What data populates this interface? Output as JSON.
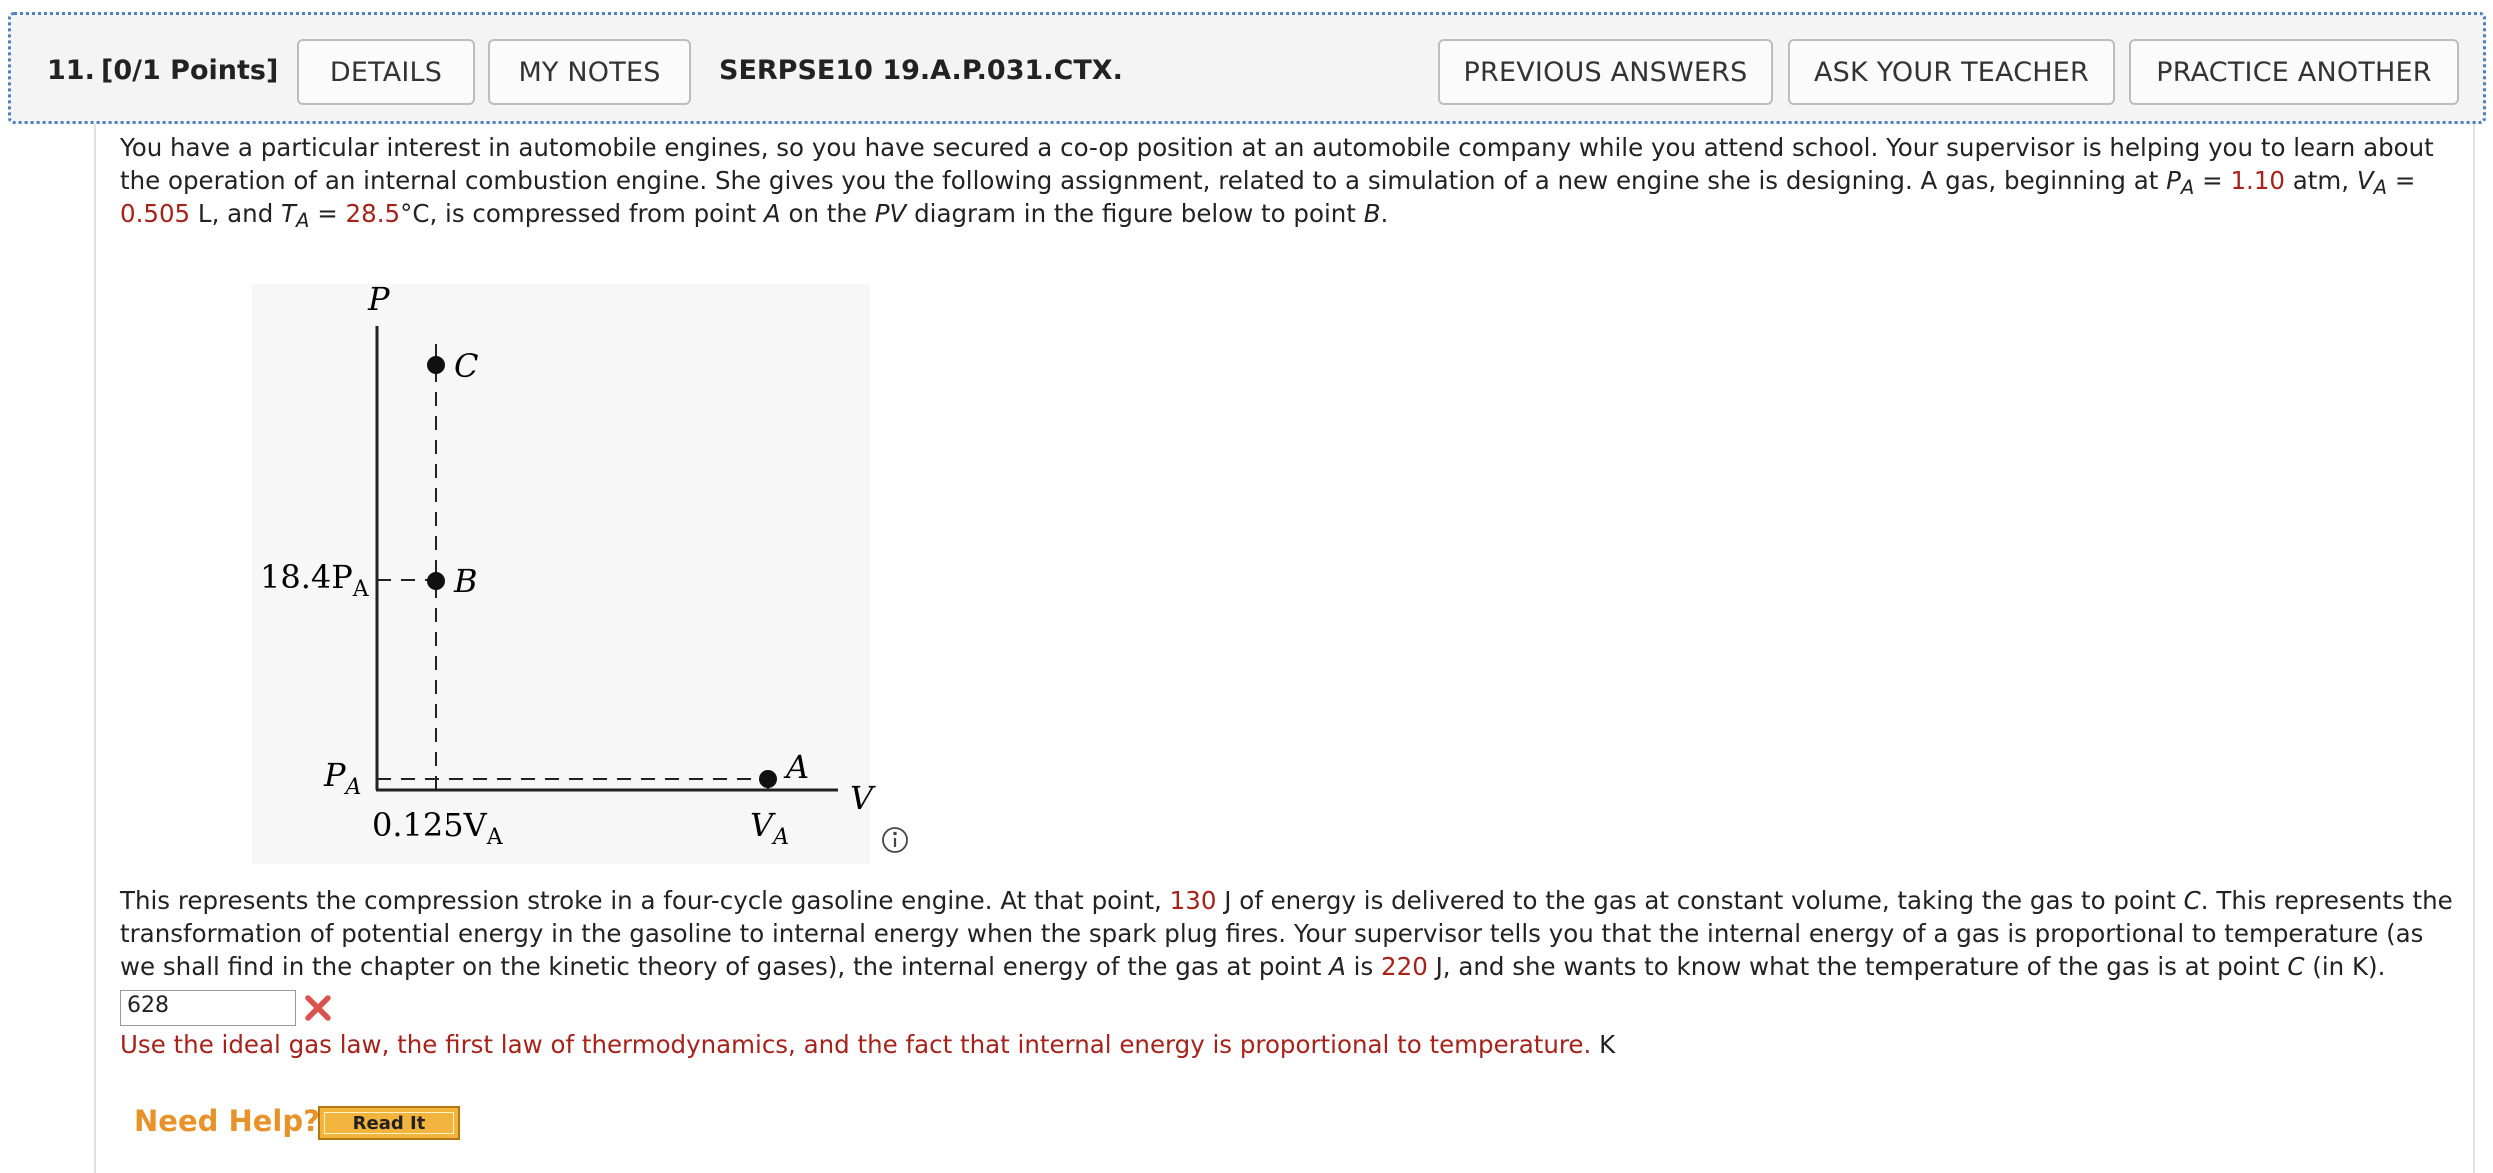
{
  "header": {
    "question_number": "11.",
    "points": "[0/1 Points]",
    "details_label": "DETAILS",
    "my_notes_label": "MY NOTES",
    "question_code": "SERPSE10 19.A.P.031.CTX.",
    "previous_answers_label": "PREVIOUS ANSWERS",
    "ask_teacher_label": "ASK YOUR TEACHER",
    "practice_another_label": "PRACTICE ANOTHER"
  },
  "problem": {
    "intro_1": "You have a particular interest in automobile engines, so you have secured a co-op position at an automobile company while you attend school. Your supervisor is helping you to learn about the operation of an internal combustion engine. She gives you the following assignment, related to a simulation of a new engine she is designing. A gas, beginning at ",
    "PA_symbol": "P",
    "sub_A": "A",
    "eq": " = ",
    "PA_value": "1.10",
    "PA_unit": " atm, ",
    "VA_symbol": "V",
    "VA_value": "0.505",
    "VA_unit": " L, and ",
    "TA_symbol": "T",
    "TA_value": "28.5",
    "TA_unit": "°C,",
    "intro_2a": " is compressed from point ",
    "point_A": "A",
    "intro_2b": " on the ",
    "pv": "PV",
    "intro_2c": " diagram in the figure below to point ",
    "point_B": "B",
    "intro_2d": ".",
    "para2_a": "This represents the compression stroke in a four-cycle gasoline engine. At that point, ",
    "energy_value": "130",
    "para2_b": " J of energy is delivered to the gas at constant volume, taking the gas to point ",
    "point_C": "C",
    "para2_c": ". This represents the transformation of potential energy in the gasoline to internal energy when the spark plug fires. Your supervisor tells you that the internal energy of a gas is proportional to temperature (as we shall find in the chapter on the kinetic theory of gases), the internal energy of the gas at point ",
    "para2_d": " is ",
    "internal_energy_value": "220",
    "para2_e": " J, and she wants to know what the temperature of the gas is at point ",
    "para2_f": " (in K)."
  },
  "diagram": {
    "axis_p": "P",
    "axis_v": "V",
    "label_c": "C",
    "label_b": "B",
    "label_a": "A",
    "p_high": "18.4P",
    "p_high_sub": "A",
    "p_low": "P",
    "p_low_sub": "A",
    "v_low": "0.125V",
    "v_low_sub": "A",
    "v_high": "V",
    "v_high_sub": "A",
    "info_icon": "info-icon"
  },
  "answer": {
    "value": "628",
    "status_icon": "incorrect-x-icon",
    "hint": "Use the ideal gas law, the first law of thermodynamics, and the fact that internal energy is proportional to temperature.",
    "unit": "K"
  },
  "help": {
    "need_help": "Need Help?",
    "read_it": "Read It"
  },
  "colors": {
    "value_red": "#a6221a",
    "header_border": "#4f7fbf",
    "need_help_orange": "#e8932a",
    "read_it_gold": "#f2b43c"
  }
}
